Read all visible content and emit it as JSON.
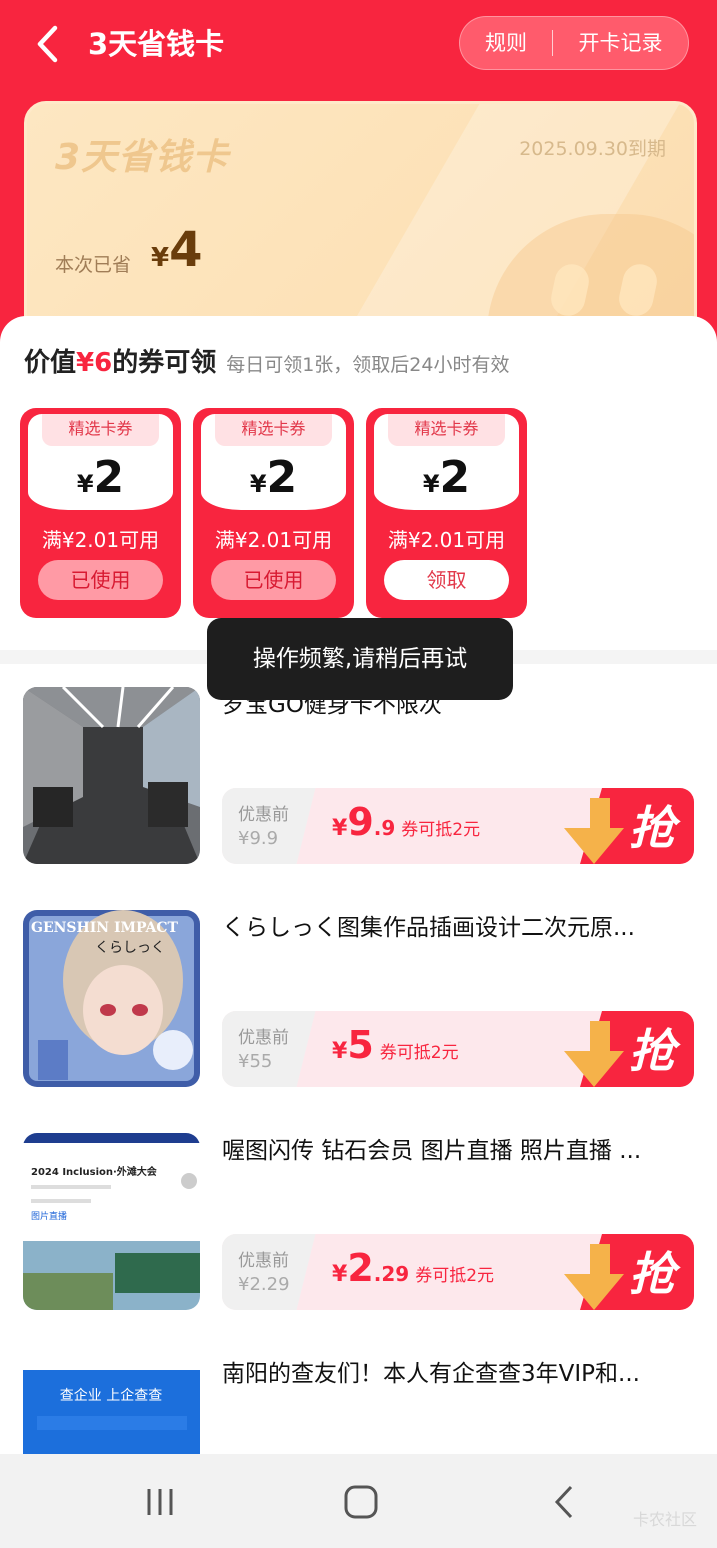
{
  "header": {
    "title": "3天省钱卡",
    "rules": "规则",
    "records": "开卡记录"
  },
  "card": {
    "name": "3天省钱卡",
    "expiry": "2025.09.30到期",
    "saved_label": "本次已省",
    "saved_currency": "¥",
    "saved_amount": "4"
  },
  "coupon_section": {
    "title_prefix": "价值",
    "title_value": "¥6",
    "title_suffix": "的券可领",
    "subtitle": "每日可领1张，领取后24小时有效",
    "coupons": [
      {
        "tag": "精选卡券",
        "currency": "¥",
        "value": "2",
        "condition": "满¥2.01可用",
        "button": "已使用",
        "state": "used"
      },
      {
        "tag": "精选卡券",
        "currency": "¥",
        "value": "2",
        "condition": "满¥2.01可用",
        "button": "已使用",
        "state": "used"
      },
      {
        "tag": "精选卡券",
        "currency": "¥",
        "value": "2",
        "condition": "满¥2.01可用",
        "button": "领取",
        "state": "available"
      }
    ]
  },
  "toast": "操作频繁,请稍后再试",
  "products": [
    {
      "title": "岁宝GO健身卡不限次",
      "orig_label": "优惠前",
      "orig_price": "¥9.9",
      "currency": "¥",
      "price_int": "9",
      "price_dec": ".9",
      "note": "券可抵2元",
      "grab": "抢"
    },
    {
      "title": "くらしっく图集作品插画设计二次元原...",
      "orig_label": "优惠前",
      "orig_price": "¥55",
      "currency": "¥",
      "price_int": "5",
      "price_dec": "",
      "note": "券可抵2元",
      "grab": "抢"
    },
    {
      "title": "喔图闪传 钻石会员 图片直播 照片直播 ...",
      "orig_label": "优惠前",
      "orig_price": "¥2.29",
      "currency": "¥",
      "price_int": "2",
      "price_dec": ".29",
      "note": "券可抵2元",
      "grab": "抢"
    },
    {
      "title": "南阳的查友们！本人有企查查3年VIP和..."
    }
  ],
  "thumb_texts": {
    "genshin": "GENSHIN IMPACT",
    "kura": "くらしっく",
    "event": "2024 Inclusion·外滩大会",
    "event_tab": "图片直播",
    "qcc": "查企业 上企查查"
  },
  "watermark": "卡农社区",
  "colors": {
    "brand_red": "#f8253f",
    "card_gold": "#fde2b8"
  }
}
